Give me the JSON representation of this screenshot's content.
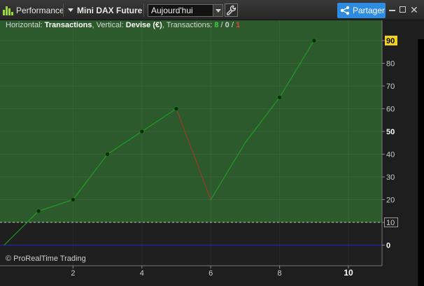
{
  "toolbar": {
    "section_label": "Performance",
    "instrument": "Mini DAX Future",
    "period_value": "Aujourd'hui",
    "share_label": "Partager",
    "close_glyph": "✕"
  },
  "header": {
    "horizontal_label": "Horizontal: ",
    "horizontal_value": "Transactions",
    "vertical_label": ", Vertical: ",
    "vertical_value": "Devise (€)",
    "transactions_label": ", Transactions: ",
    "wins": "8",
    "sep1": " / ",
    "neutral": "0",
    "sep2": " / ",
    "losses": "1"
  },
  "copyright": "© ProRealTime Trading",
  "colors": {
    "gain_fill": "#2d5a2d",
    "gain_line": "#1f9d1f",
    "loss_line": "#9b3b2a",
    "zero_line": "#2222cc",
    "marker": "#0b2b0b",
    "last_price_bg": "#f0d020"
  },
  "chart_data": {
    "type": "line",
    "title": "",
    "xlabel": "",
    "ylabel": "",
    "xlim": [
      0,
      11
    ],
    "ylim": [
      -10,
      95
    ],
    "x_ticks": [
      2,
      4,
      6,
      8,
      10
    ],
    "y_ticks": [
      0,
      10,
      20,
      30,
      40,
      50,
      60,
      70,
      80,
      90
    ],
    "y_tick_labels": [
      "0",
      "10",
      "20",
      "30",
      "40",
      "50",
      "60",
      "70",
      "80",
      "90"
    ],
    "bold_x_ticks": [
      10
    ],
    "bold_y_ticks": [
      0,
      50,
      90
    ],
    "highlight_y_ticks": [
      90
    ],
    "boxed_y_ticks": [
      10
    ],
    "grid": true,
    "x": [
      0,
      1,
      2,
      3,
      4,
      5,
      6,
      7,
      8,
      9
    ],
    "y": [
      0,
      15,
      20,
      40,
      50,
      60,
      20,
      45,
      65,
      90
    ],
    "markers_at": [
      1,
      2,
      3,
      4,
      5,
      8,
      9
    ],
    "losing_segments": [
      5
    ],
    "reference_line": {
      "y": 10,
      "style": "dashed"
    },
    "zero_line": {
      "y": 0
    }
  }
}
